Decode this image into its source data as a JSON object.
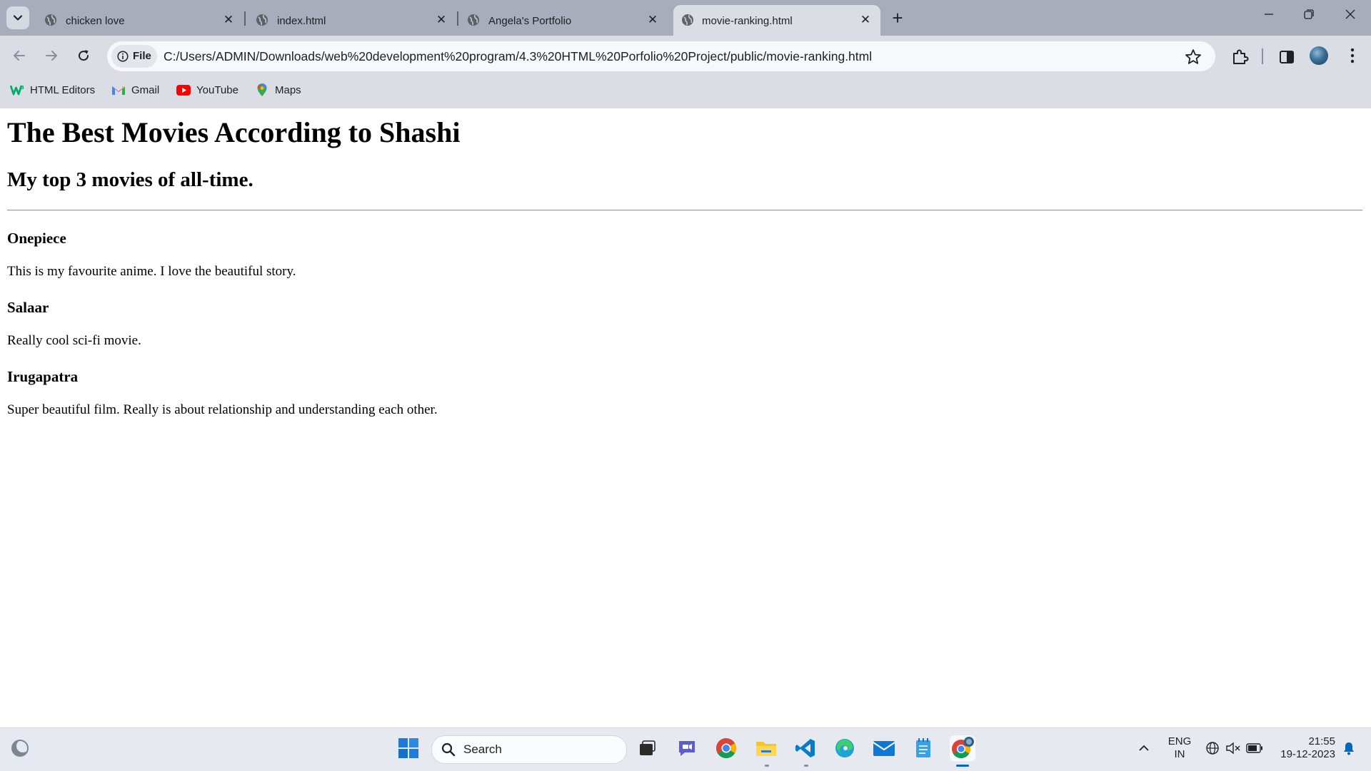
{
  "browser": {
    "tabs": [
      {
        "label": "chicken love",
        "active": false
      },
      {
        "label": "index.html",
        "active": false
      },
      {
        "label": "Angela's Portfolio",
        "active": false
      },
      {
        "label": "movie-ranking.html",
        "active": true
      }
    ],
    "site_info_label": "File",
    "url": "C:/Users/ADMIN/Downloads/web%20development%20program/4.3%20HTML%20Porfolio%20Project/public/movie-ranking.html",
    "bookmarks": [
      {
        "label": "HTML Editors",
        "icon": "w3schools-icon"
      },
      {
        "label": "Gmail",
        "icon": "gmail-icon"
      },
      {
        "label": "YouTube",
        "icon": "youtube-icon"
      },
      {
        "label": "Maps",
        "icon": "maps-icon"
      }
    ]
  },
  "page": {
    "title": "The Best Movies According to Shashi",
    "subtitle": "My top 3 movies of all-time.",
    "movies": [
      {
        "name": "Onepiece",
        "description": "This is my favourite anime. I love the beautiful story."
      },
      {
        "name": "Salaar",
        "description": "Really cool sci-fi movie."
      },
      {
        "name": "Irugapatra",
        "description": "Super beautiful film. Really is about relationship and understanding each other."
      }
    ]
  },
  "taskbar": {
    "search_label": "Search",
    "language": "ENG",
    "region": "IN",
    "time": "21:55",
    "date": "19-12-2023"
  },
  "colors": {
    "tab_strip": "#a7adba",
    "toolbar": "#dadde3",
    "taskbar": "#e6eaf0",
    "accent": "#0067c0"
  }
}
